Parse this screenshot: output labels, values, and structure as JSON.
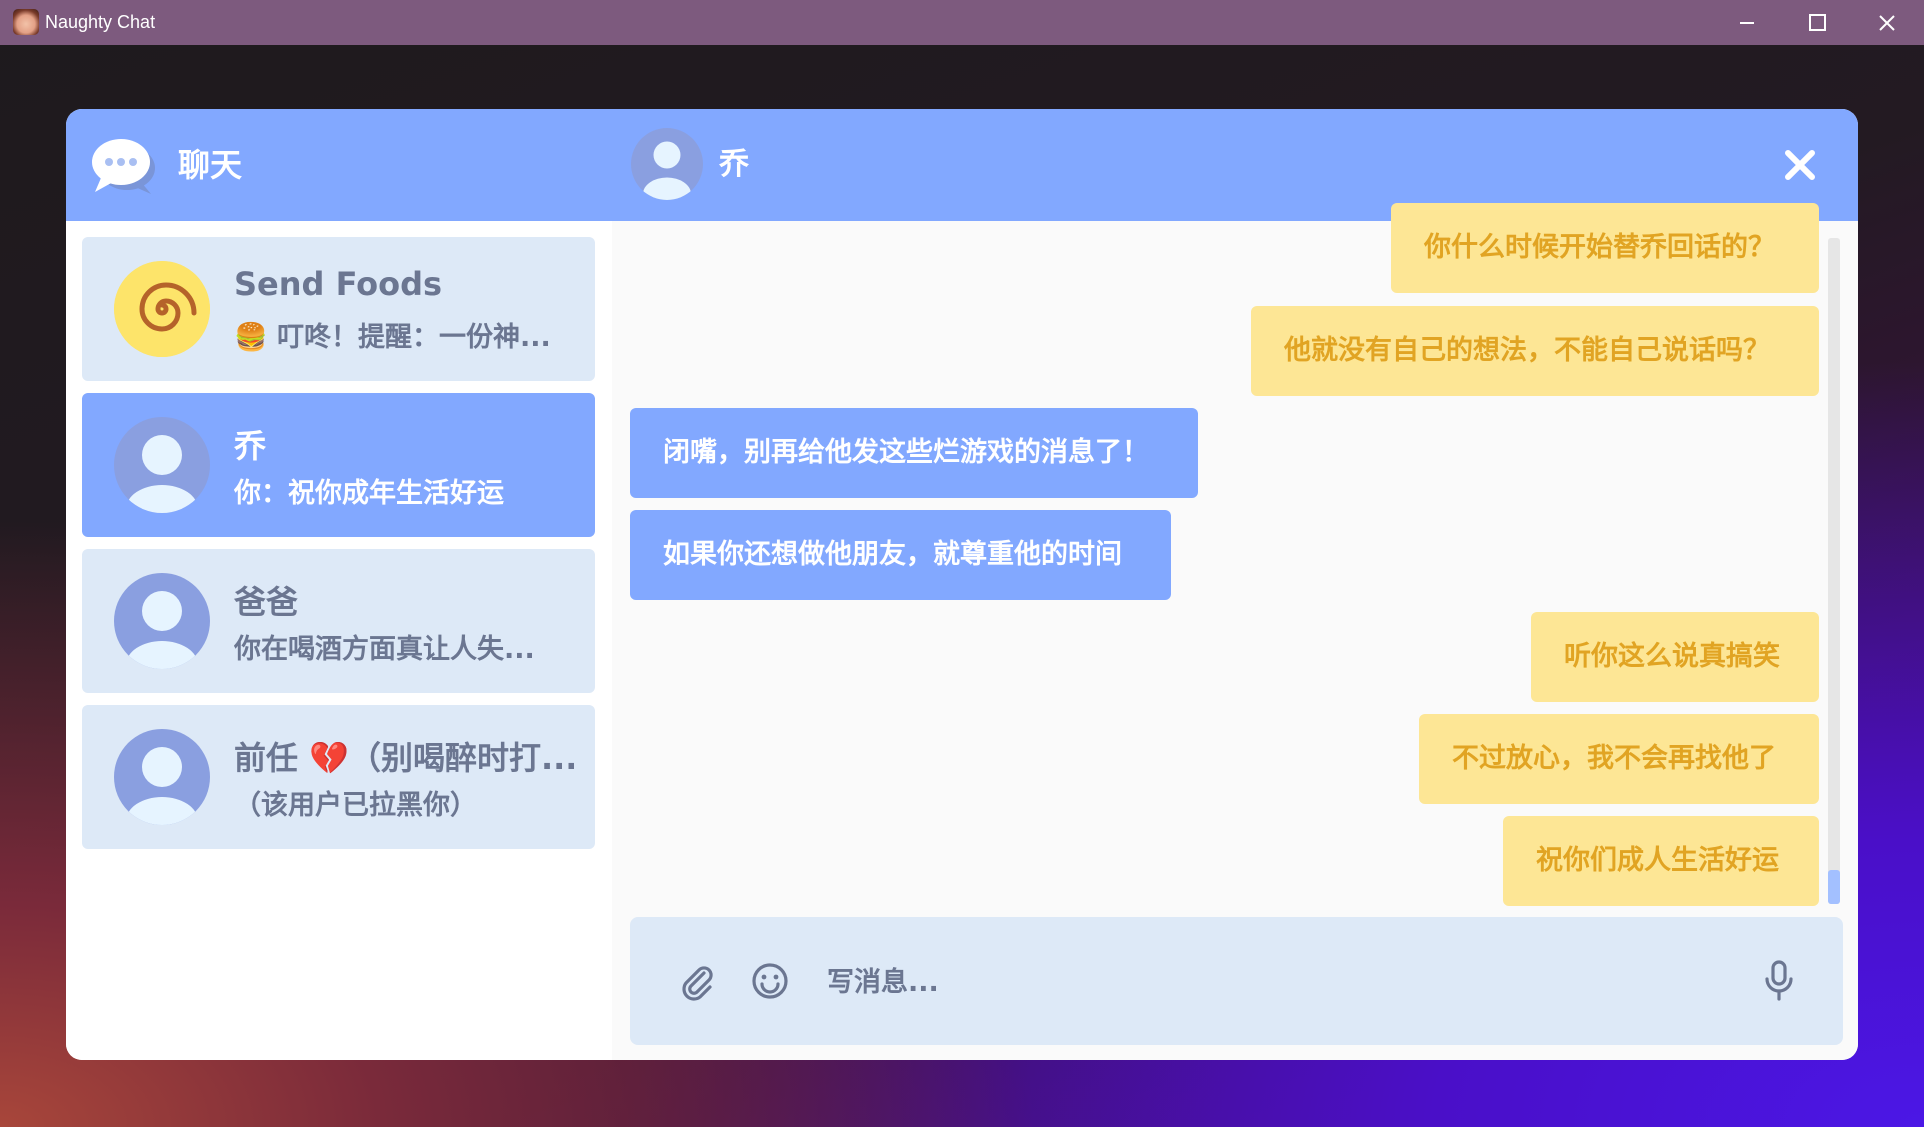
{
  "window": {
    "title": "Naughty Chat"
  },
  "header": {
    "chats_title": "聊天",
    "active_contact_name": "乔"
  },
  "contacts": [
    {
      "name": "Send Foods",
      "preview": "🍔 叮咚！提醒：一份神...",
      "avatar": "spiral-icon",
      "active": false
    },
    {
      "name": "乔",
      "preview": "你：祝你成年生活好运",
      "avatar": "user-avatar",
      "active": true
    },
    {
      "name": "爸爸",
      "preview": "你在喝酒方面真让人失...",
      "avatar": "user-avatar",
      "active": false
    },
    {
      "name": "前任 💔（别喝醉时打...",
      "preview": "（该用户已拉黑你）",
      "avatar": "user-avatar",
      "active": false
    }
  ],
  "messages": [
    {
      "text": "你什么时候开始替乔回话的？",
      "from": "me"
    },
    {
      "text": "他就没有自己的想法，不能自己说话吗？",
      "from": "me"
    },
    {
      "text": "闭嘴，别再给他发这些烂游戏的消息了！",
      "from": "them"
    },
    {
      "text": "如果你还想做他朋友，就尊重他的时间",
      "from": "them"
    },
    {
      "text": "听你这么说真搞笑",
      "from": "me"
    },
    {
      "text": "不过放心，我不会再找他了",
      "from": "me"
    },
    {
      "text": "祝你们成人生活好运",
      "from": "me"
    }
  ],
  "composer": {
    "placeholder": "写消息...",
    "value": ""
  },
  "colors": {
    "header": "#82a8ff",
    "contact_bg": "#dde9f7",
    "my_bubble": "#fde695",
    "my_text": "#e1a423",
    "their_bubble": "#82a8ff"
  }
}
